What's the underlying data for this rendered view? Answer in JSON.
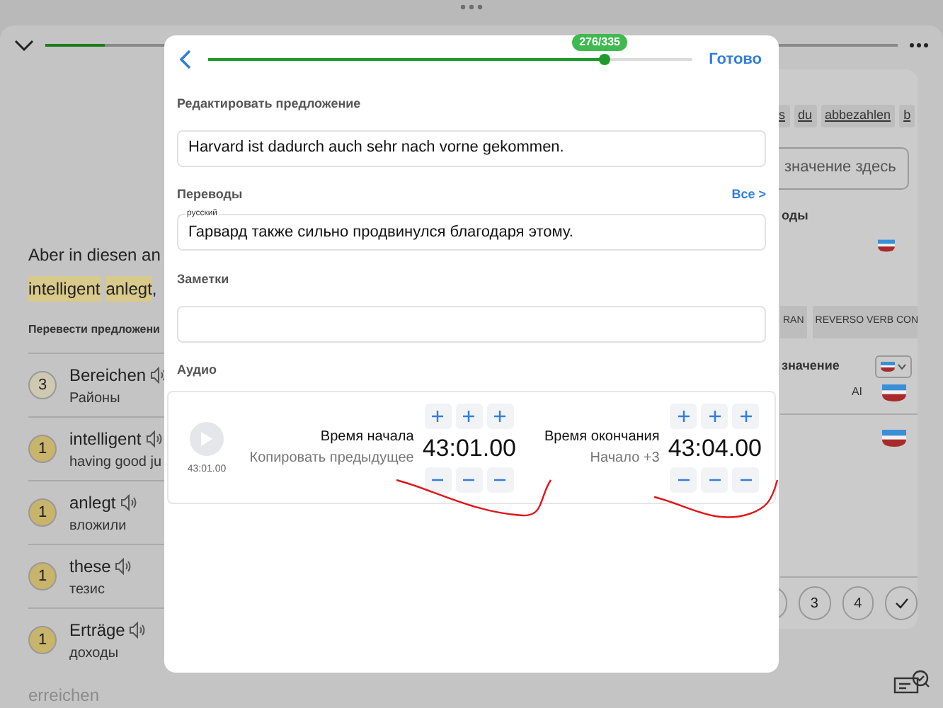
{
  "background": {
    "progress": {
      "level": 0.07
    },
    "sentence": {
      "line_1": "Aber in diesen an",
      "highlights": [
        {
          "text": "intelligent"
        },
        {
          "text": "anlegt"
        }
      ],
      "tail": ","
    },
    "translate_label": "Перевести предложени",
    "words": [
      {
        "count": "3",
        "word": "Bereichen",
        "translation": "Районы",
        "known": false
      },
      {
        "count": "1",
        "word": "intelligent",
        "translation": "having good ju",
        "known": true
      },
      {
        "count": "1",
        "word": "anlegt",
        "translation": "вложили",
        "known": true
      },
      {
        "count": "1",
        "word": "these",
        "translation": "тезис",
        "known": true
      },
      {
        "count": "1",
        "word": "Erträge",
        "translation": "доходы",
        "known": true
      }
    ],
    "faded_word": "erreichen",
    "side": {
      "chips": [
        "s",
        "du",
        "abbezahlen",
        "b"
      ],
      "meaning_field": "значение здесь",
      "section_label": "оды",
      "tools": [
        "RAN",
        "REVERSO VERB CON"
      ],
      "meaning_label": "значение",
      "ai_label": "AI",
      "ratings": [
        "3",
        "4"
      ]
    }
  },
  "modal": {
    "progress": {
      "level": 0.82,
      "badge": "276/335"
    },
    "done": "Готово",
    "sentence_label": "Редактировать предложение",
    "sentence": "Harvard ist dadurch auch sehr nach vorne gekommen.",
    "translations_label": "Переводы",
    "all_link": "Все >",
    "translation_lang": "русский",
    "translation": "Гарвард также сильно продвинулся благодаря этому.",
    "notes_label": "Заметки",
    "audio_label": "Аудио",
    "audio_duration": "43:01.00",
    "times": [
      {
        "label": "Время начала",
        "hint": "Копировать предыдущее",
        "value": "43:01.00"
      },
      {
        "label": "Время окончания",
        "hint": "Начало +3",
        "value": "43:04.00"
      }
    ]
  }
}
